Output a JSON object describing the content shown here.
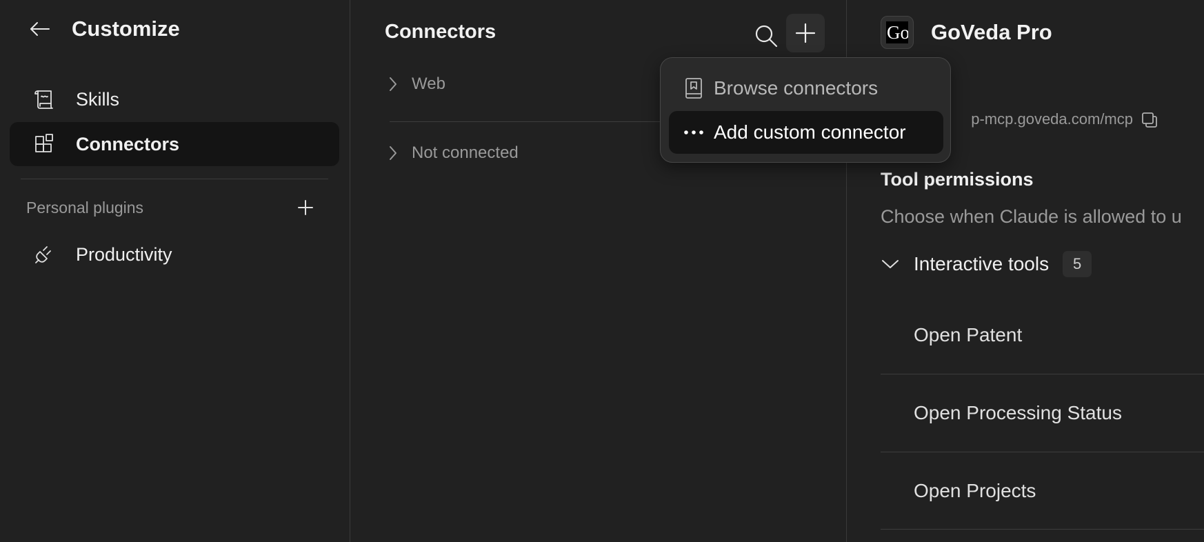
{
  "sidebar": {
    "title": "Customize",
    "nav": [
      {
        "label": "Skills",
        "icon": "scroll-icon"
      },
      {
        "label": "Connectors",
        "icon": "connectors-icon",
        "active": true
      }
    ],
    "section_label": "Personal plugins",
    "plugins": [
      {
        "label": "Productivity",
        "icon": "plug-icon"
      }
    ]
  },
  "middle": {
    "title": "Connectors",
    "groups": [
      {
        "label": "Web"
      },
      {
        "label": "Not connected"
      }
    ]
  },
  "menu": {
    "items": [
      {
        "label": "Browse connectors",
        "icon": "book-icon"
      },
      {
        "label": "Add custom connector",
        "icon": "more-dots-icon",
        "highlighted": true
      }
    ]
  },
  "detail": {
    "logo_text": "Go",
    "title": "GoVeda Pro",
    "url": "p-mcp.goveda.com/mcp",
    "permissions_title": "Tool permissions",
    "permissions_desc": "Choose when Claude is allowed to u",
    "group_label": "Interactive tools",
    "group_count": "5",
    "tools": [
      "Open Patent",
      "Open Processing Status",
      "Open Projects"
    ]
  },
  "colors": {
    "background": "#212121",
    "active_item": "#141414",
    "menu_bg": "#2a2a2a",
    "text_primary": "#f2f2f2",
    "text_muted": "#9a9a9a"
  }
}
